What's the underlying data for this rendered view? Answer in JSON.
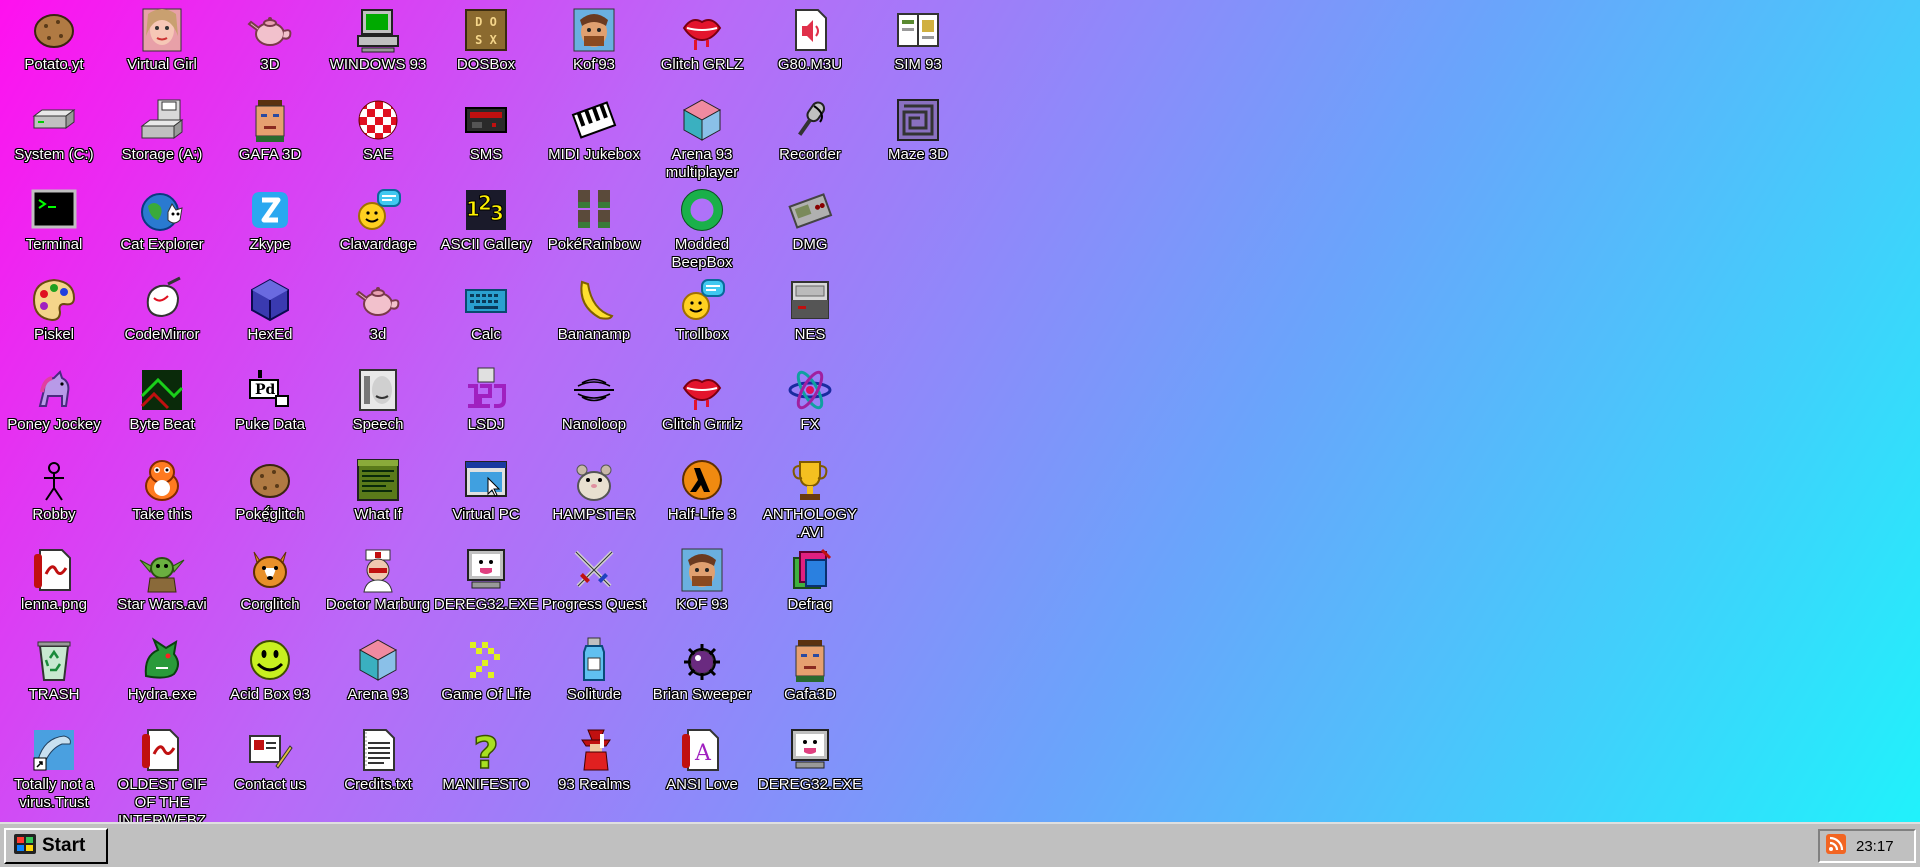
{
  "desktop": {
    "icons": [
      {
        "label": "Potato.yt",
        "icon": "potato-icon",
        "col": 0,
        "row": 0
      },
      {
        "label": "Virtual Girl",
        "icon": "virtual-girl-icon",
        "col": 1,
        "row": 0
      },
      {
        "label": "3D",
        "icon": "teapot-icon",
        "col": 2,
        "row": 0
      },
      {
        "label": "WINDOWS 93",
        "icon": "computer-icon",
        "col": 3,
        "row": 0
      },
      {
        "label": "DOSBox",
        "icon": "dosbox-icon",
        "col": 4,
        "row": 0
      },
      {
        "label": "Kof'93",
        "icon": "fighter-portrait-icon",
        "col": 5,
        "row": 0
      },
      {
        "label": "Glitch GRLZ",
        "icon": "glitch-lips-icon",
        "col": 6,
        "row": 0
      },
      {
        "label": "G80.M3U",
        "icon": "audio-file-icon",
        "col": 7,
        "row": 0
      },
      {
        "label": "SIM 93",
        "icon": "book-icon",
        "col": 8,
        "row": 0
      },
      {
        "label": "System (C:)",
        "icon": "hard-drive-icon",
        "col": 0,
        "row": 1
      },
      {
        "label": "Storage (A:)",
        "icon": "floppy-drive-icon",
        "col": 1,
        "row": 1
      },
      {
        "label": "GAFA 3D",
        "icon": "guy-face-icon",
        "col": 2,
        "row": 1
      },
      {
        "label": "SAE",
        "icon": "checker-ball-icon",
        "col": 3,
        "row": 1
      },
      {
        "label": "SMS",
        "icon": "console-icon",
        "col": 4,
        "row": 1
      },
      {
        "label": "MIDI Jukebox",
        "icon": "piano-keys-icon",
        "col": 5,
        "row": 1
      },
      {
        "label": "Arena 93 multiplayer",
        "icon": "cube-icon",
        "col": 6,
        "row": 1
      },
      {
        "label": "Recorder",
        "icon": "microphone-icon",
        "col": 7,
        "row": 1
      },
      {
        "label": "Maze 3D",
        "icon": "maze-icon",
        "col": 8,
        "row": 1
      },
      {
        "label": "Terminal",
        "icon": "terminal-icon",
        "col": 0,
        "row": 2
      },
      {
        "label": "Cat Explorer",
        "icon": "cat-globe-icon",
        "col": 1,
        "row": 2
      },
      {
        "label": "Zkype",
        "icon": "zkype-icon",
        "col": 2,
        "row": 2
      },
      {
        "label": "Clavardage",
        "icon": "chat-smiley-icon",
        "col": 3,
        "row": 2
      },
      {
        "label": "ASCII Gallery",
        "icon": "numbers-123-icon",
        "col": 4,
        "row": 2
      },
      {
        "label": "PokéRainbow",
        "icon": "sprite-group-icon",
        "col": 5,
        "row": 2
      },
      {
        "label": "Modded BeepBox",
        "icon": "ring-icon",
        "col": 6,
        "row": 2
      },
      {
        "label": "DMG",
        "icon": "gameboy-icon",
        "col": 7,
        "row": 2
      },
      {
        "label": "Piskel",
        "icon": "palette-icon",
        "col": 0,
        "row": 3
      },
      {
        "label": "CodeMirror",
        "icon": "codemirror-icon",
        "col": 1,
        "row": 3
      },
      {
        "label": "HexEd",
        "icon": "hex-cube-icon",
        "col": 2,
        "row": 3
      },
      {
        "label": "3d",
        "icon": "teapot-icon",
        "col": 3,
        "row": 3
      },
      {
        "label": "Calc",
        "icon": "keyboard-icon",
        "col": 4,
        "row": 3
      },
      {
        "label": "Bananamp",
        "icon": "banana-icon",
        "col": 5,
        "row": 3
      },
      {
        "label": "Trollbox",
        "icon": "chat-smiley-icon",
        "col": 6,
        "row": 3
      },
      {
        "label": "NES",
        "icon": "nes-console-icon",
        "col": 7,
        "row": 3
      },
      {
        "label": "Poney Jockey",
        "icon": "pony-icon",
        "col": 0,
        "row": 4
      },
      {
        "label": "Byte Beat",
        "icon": "bytebeat-icon",
        "col": 1,
        "row": 4
      },
      {
        "label": "Puke Data",
        "icon": "puredata-icon",
        "col": 2,
        "row": 4
      },
      {
        "label": "Speech",
        "icon": "speech-face-icon",
        "col": 3,
        "row": 4
      },
      {
        "label": "LSDJ",
        "icon": "lsdj-icon",
        "col": 4,
        "row": 4
      },
      {
        "label": "Nanoloop",
        "icon": "wave-icon",
        "col": 5,
        "row": 4
      },
      {
        "label": "Glitch Grrrlz",
        "icon": "glitch-lips-icon",
        "col": 6,
        "row": 4
      },
      {
        "label": "FX",
        "icon": "atom-icon",
        "col": 7,
        "row": 4
      },
      {
        "label": "Robby",
        "icon": "stick-figure-icon",
        "col": 0,
        "row": 5
      },
      {
        "label": "Take this",
        "icon": "orange-creature-icon",
        "col": 1,
        "row": 5
      },
      {
        "label": "Poké̤̈́glitch",
        "icon": "potato-icon",
        "col": 2,
        "row": 5
      },
      {
        "label": "What If",
        "icon": "text-window-icon",
        "col": 3,
        "row": 5
      },
      {
        "label": "Virtual PC",
        "icon": "window-cursor-icon",
        "col": 4,
        "row": 5
      },
      {
        "label": "HAMPSTER",
        "icon": "hamster-icon",
        "col": 5,
        "row": 5
      },
      {
        "label": "Half-Life 3",
        "icon": "halflife-icon",
        "col": 6,
        "row": 5
      },
      {
        "label": "ANTHOLOGY .AVI",
        "icon": "trophy-icon",
        "col": 7,
        "row": 5
      },
      {
        "label": "lenna.png",
        "icon": "pdf-doc-icon",
        "col": 0,
        "row": 6
      },
      {
        "label": "Star Wars.avi",
        "icon": "yoda-icon",
        "col": 1,
        "row": 6
      },
      {
        "label": "Corglitch",
        "icon": "corgi-icon",
        "col": 2,
        "row": 6
      },
      {
        "label": "Doctor Marburg",
        "icon": "doctor-icon",
        "col": 3,
        "row": 6
      },
      {
        "label": "DEREG32.EXE",
        "icon": "monitor-face-icon",
        "col": 4,
        "row": 6
      },
      {
        "label": "Progress Quest",
        "icon": "swords-icon",
        "col": 5,
        "row": 6
      },
      {
        "label": "KOF 93",
        "icon": "fighter-portrait-icon",
        "col": 6,
        "row": 6
      },
      {
        "label": "Defrag",
        "icon": "defrag-icon",
        "col": 7,
        "row": 6
      },
      {
        "label": "TRASH",
        "icon": "recycle-bin-icon",
        "col": 0,
        "row": 7
      },
      {
        "label": "Hydra.exe",
        "icon": "dragon-icon",
        "col": 1,
        "row": 7
      },
      {
        "label": "Acid Box 93",
        "icon": "acid-smiley-icon",
        "col": 2,
        "row": 7
      },
      {
        "label": "Arena 93",
        "icon": "cube-icon",
        "col": 3,
        "row": 7
      },
      {
        "label": "Game Of Life",
        "icon": "game-of-life-icon",
        "col": 4,
        "row": 7
      },
      {
        "label": "Solitude",
        "icon": "bottle-icon",
        "col": 5,
        "row": 7
      },
      {
        "label": "Brian Sweeper",
        "icon": "mine-icon",
        "col": 6,
        "row": 7
      },
      {
        "label": "Gafa3D",
        "icon": "guy-face-icon",
        "col": 7,
        "row": 7
      },
      {
        "label": "Totally not a virus.Trust",
        "icon": "dolphin-shortcut-icon",
        "col": 0,
        "row": 8
      },
      {
        "label": "OLDEST GIF OF THE INTERWEBZ",
        "icon": "pdf-doc-icon",
        "col": 1,
        "row": 8
      },
      {
        "label": "Contact us",
        "icon": "contact-card-icon",
        "col": 2,
        "row": 8
      },
      {
        "label": "Credits.txt",
        "icon": "text-file-icon",
        "col": 3,
        "row": 8
      },
      {
        "label": "MANIFESTO",
        "icon": "question-mark-icon",
        "col": 4,
        "row": 8
      },
      {
        "label": "93 Realms",
        "icon": "red-mage-icon",
        "col": 5,
        "row": 8
      },
      {
        "label": "ANSI Love",
        "icon": "ansi-doc-icon",
        "col": 6,
        "row": 8
      },
      {
        "label": "DEREG32.EXE",
        "icon": "monitor-face-icon",
        "col": 7,
        "row": 8
      }
    ]
  },
  "taskbar": {
    "start_label": "Start",
    "start_icon": "windows-logo-icon",
    "tray_icon": "rss-icon",
    "clock": "23:17"
  },
  "colors": {
    "gradient_start": "#ff10ef",
    "gradient_end": "#1ef4fb",
    "taskbar": "#c0c0c0"
  }
}
